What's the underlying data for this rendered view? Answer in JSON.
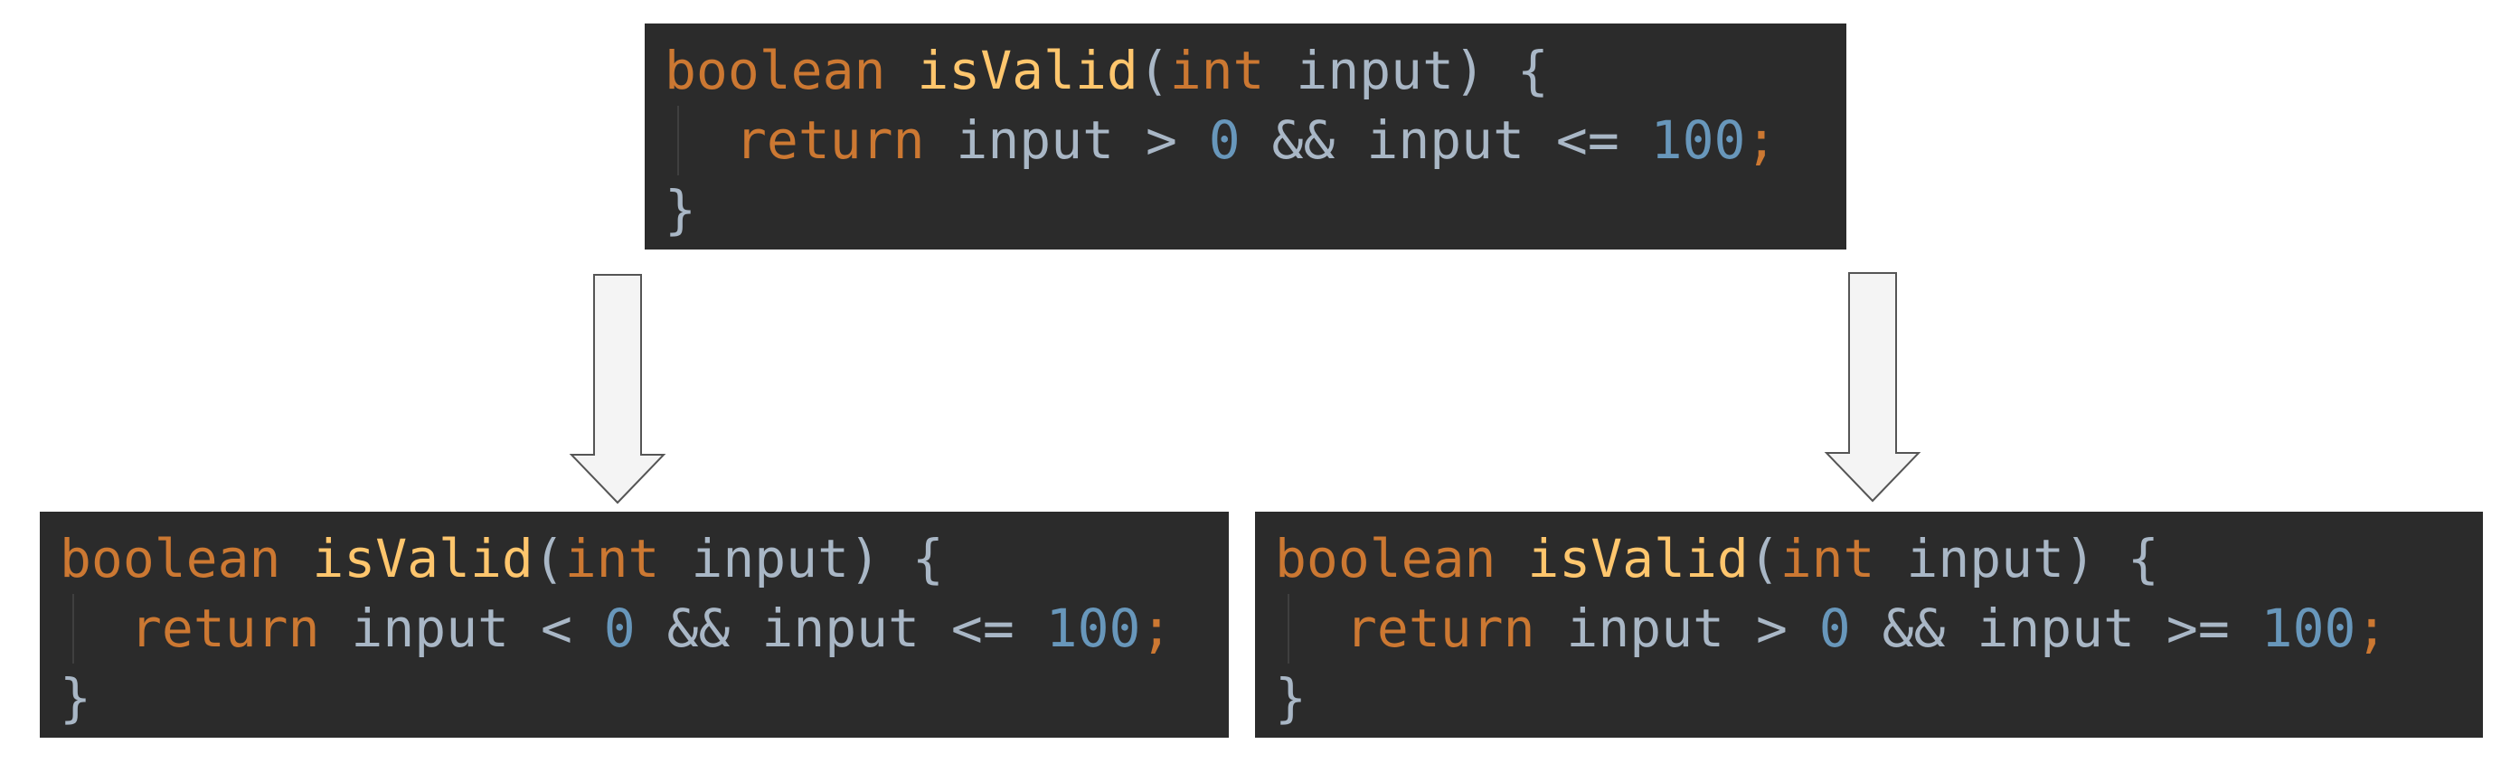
{
  "code_original": {
    "line1": {
      "t1": "boolean",
      "t2": " ",
      "t3": "isValid",
      "t4": "(",
      "t5": "int",
      "t6": " input) {"
    },
    "line2": {
      "t1": "return",
      "t2": " input > ",
      "t3": "0",
      "t4": " && input <= ",
      "t5": "100",
      "t6": ";"
    },
    "line3": "}"
  },
  "code_mutant_1": {
    "line1": {
      "t1": "boolean",
      "t2": " ",
      "t3": "isValid",
      "t4": "(",
      "t5": "int",
      "t6": " input) {"
    },
    "line2": {
      "t1": "return",
      "t2": " input < ",
      "t3": "0",
      "t4": " && input <= ",
      "t5": "100",
      "t6": ";"
    },
    "line3": "}"
  },
  "code_mutant_2": {
    "line1": {
      "t1": "boolean",
      "t2": " ",
      "t3": "isValid",
      "t4": "(",
      "t5": "int",
      "t6": " input) {"
    },
    "line2": {
      "t1": "return",
      "t2": " input > ",
      "t3": "0",
      "t4": " && input >= ",
      "t5": "100",
      "t6": ";"
    },
    "line3": "}"
  },
  "colors": {
    "background": "#2b2b2b",
    "keyword": "#cc7832",
    "function": "#ffc66d",
    "number": "#6897bb",
    "identifier": "#a9b7c6"
  },
  "icons": {
    "arrow": "down-arrow-icon"
  }
}
